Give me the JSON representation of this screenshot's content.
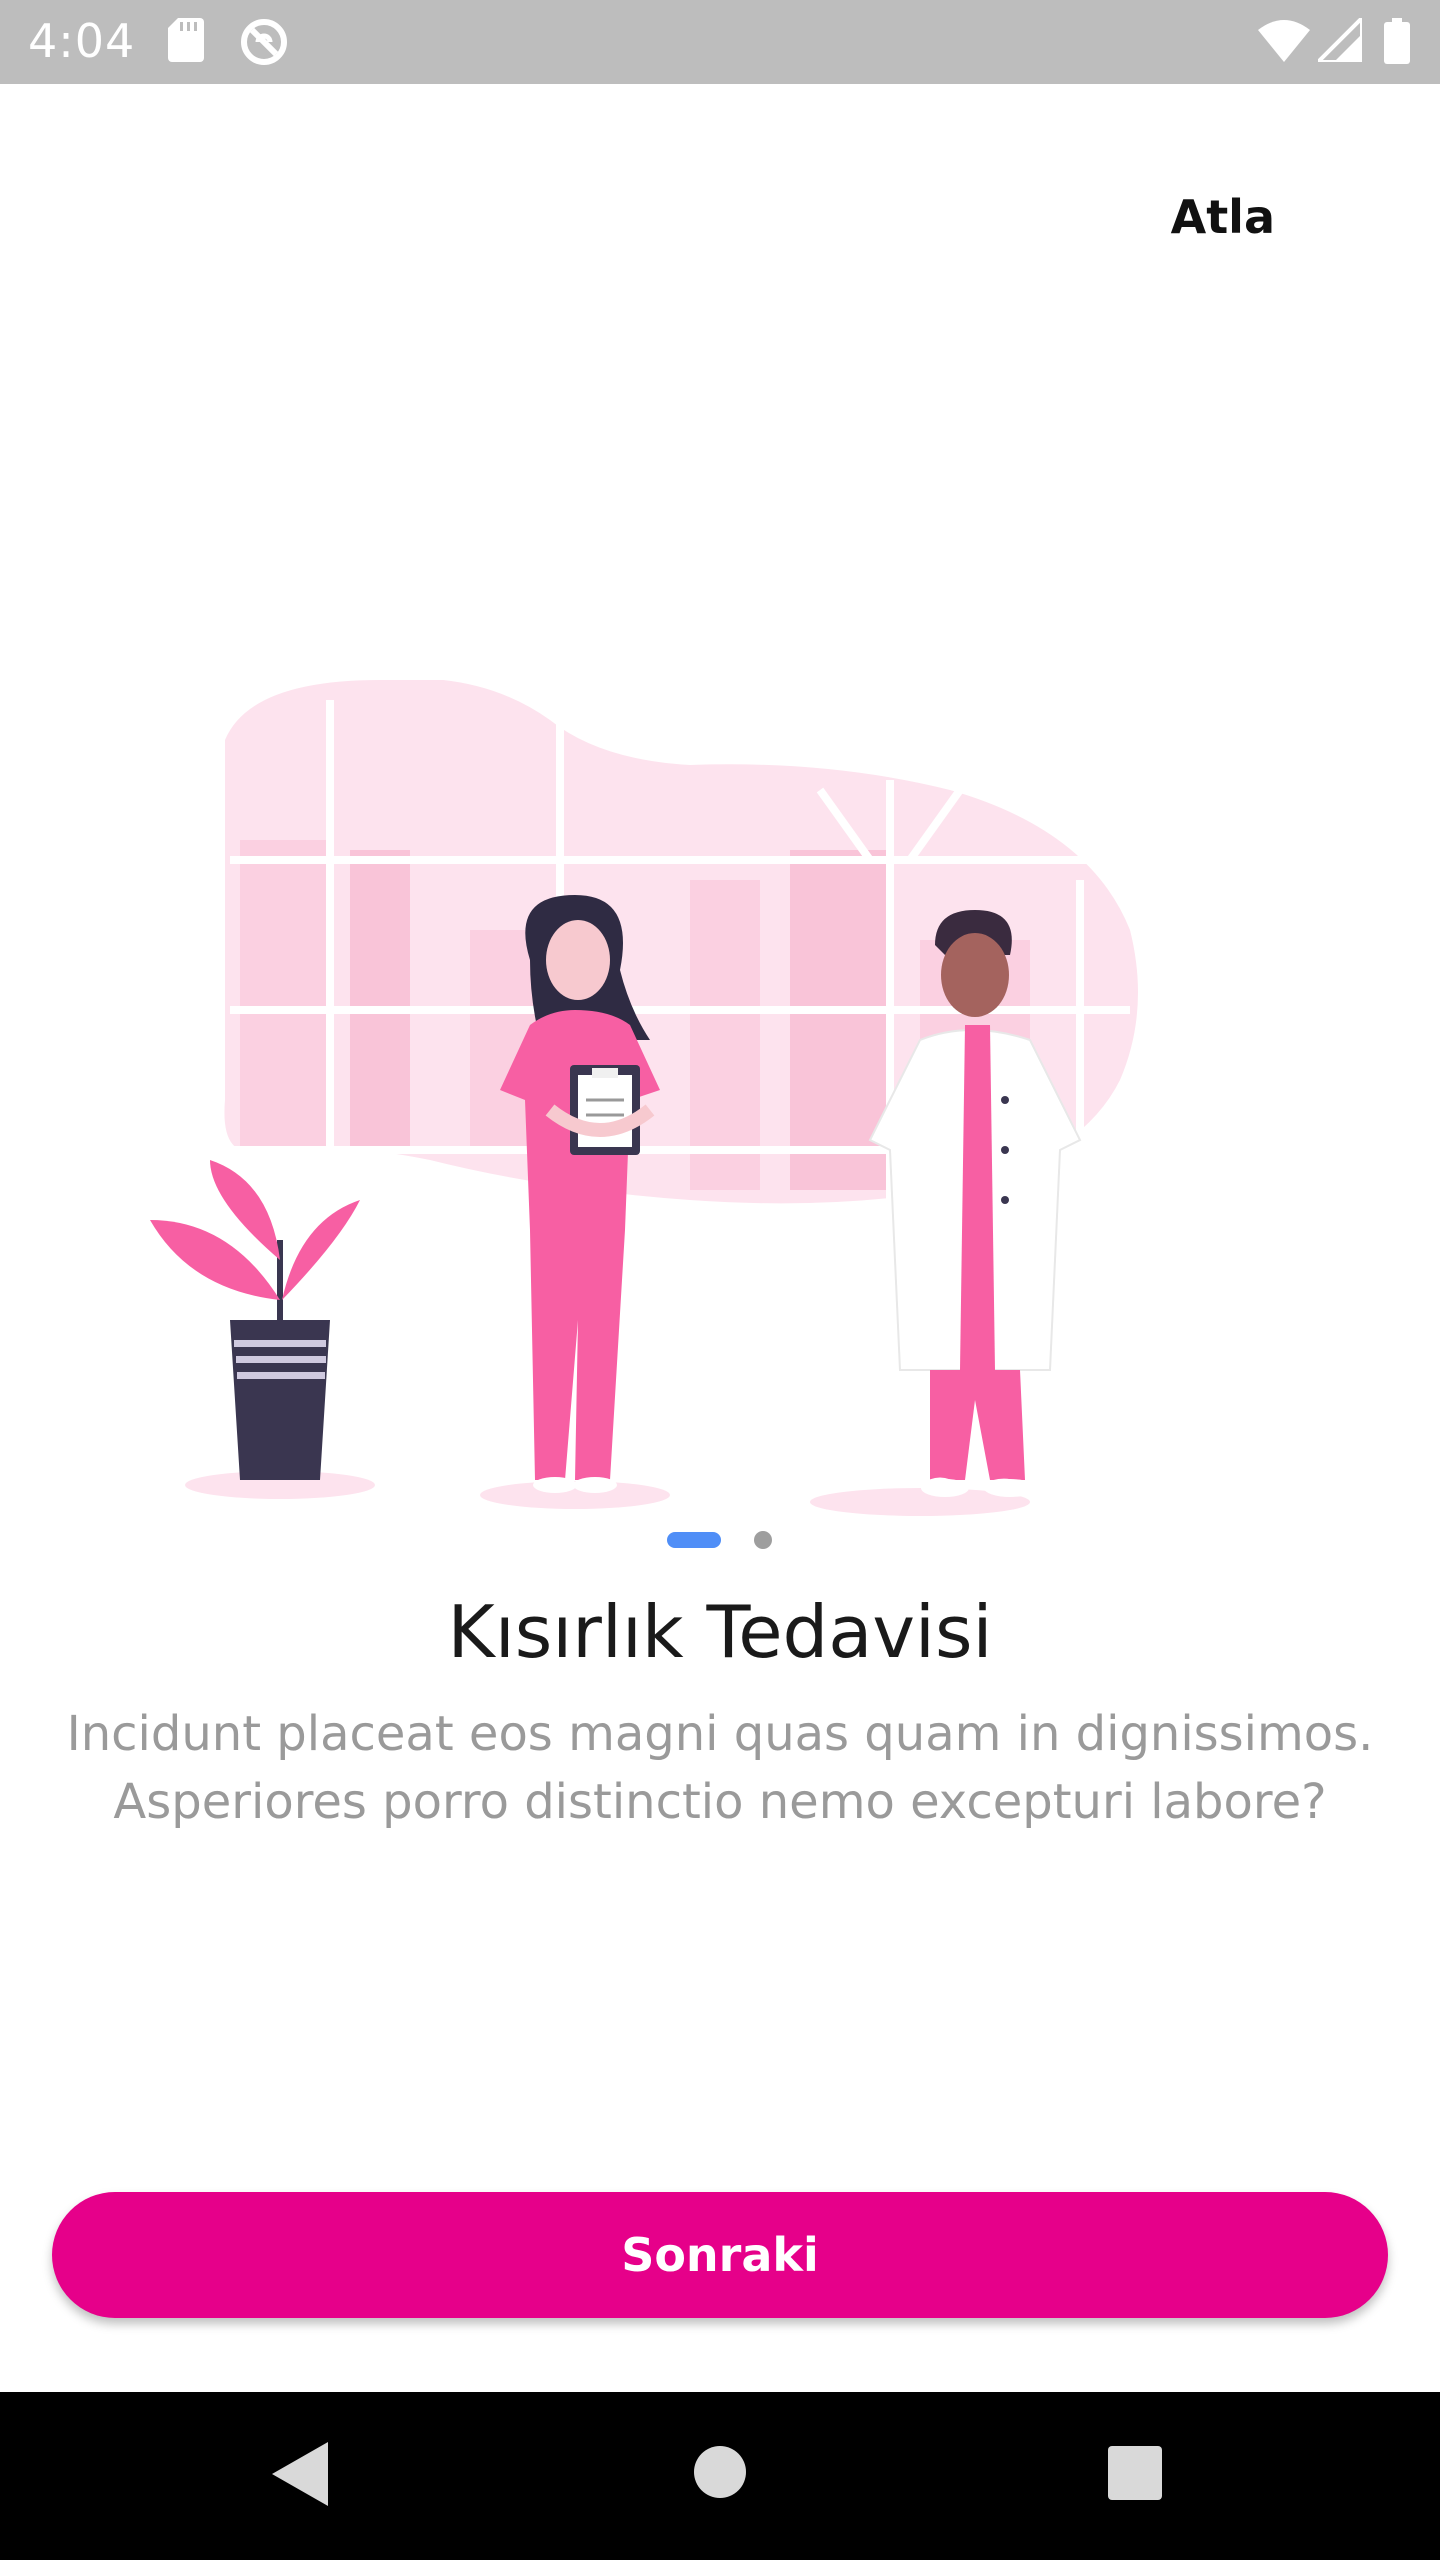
{
  "status_bar": {
    "time": "4:04",
    "icons": [
      "sd-card-icon",
      "no-sync-icon",
      "wifi-icon",
      "signal-icon",
      "battery-icon"
    ]
  },
  "header": {
    "skip_label": "Atla"
  },
  "onboarding": {
    "illustration": "medical-staff-illustration",
    "page_index": 1,
    "page_count": 2,
    "title": "Kısırlık Tedavisi",
    "description": "Incidunt placeat eos magni quas quam in dignissimos. Asperiores porro distinctio nemo excepturi labore?"
  },
  "actions": {
    "next_label": "Sonraki"
  },
  "colors": {
    "accent": "#e6008a",
    "pager_active": "#4f8ef7",
    "illustration_pink": "#f75fa3",
    "illustration_bg": "#fde3ee"
  },
  "nav_bar": {
    "icons": [
      "back-icon",
      "home-icon",
      "recents-icon"
    ]
  }
}
